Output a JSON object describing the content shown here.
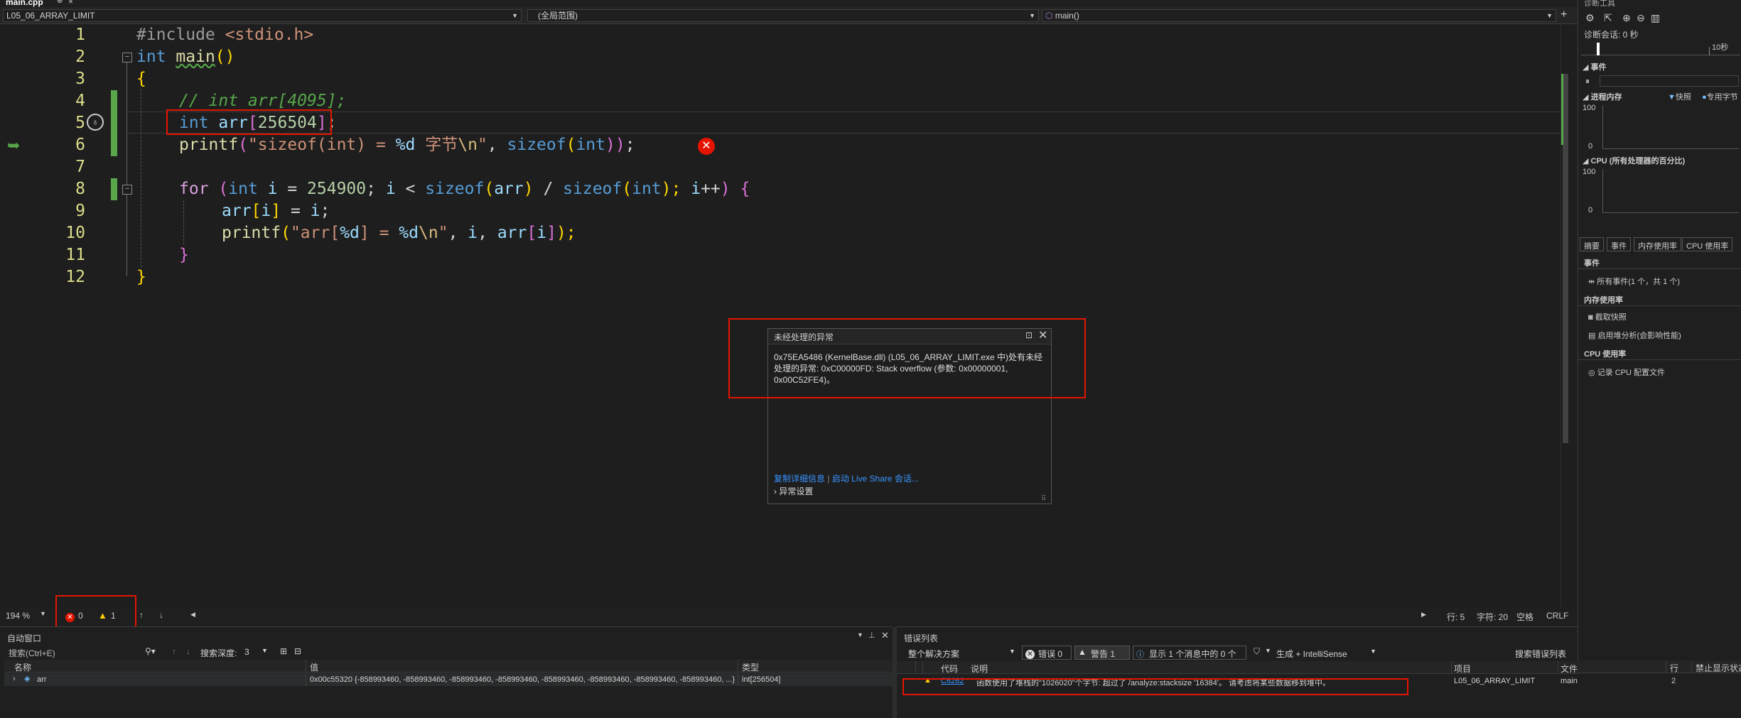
{
  "tab": {
    "filename": "main.cpp",
    "pin": "⊕",
    "close": "×"
  },
  "nav": {
    "project": "L05_06_ARRAY_LIMIT",
    "scope": "(全局范围)",
    "member": "main()"
  },
  "code": {
    "lines": [
      "1",
      "2",
      "3",
      "4",
      "5",
      "6",
      "7",
      "8",
      "9",
      "10",
      "11",
      "12"
    ],
    "l1_pp": "#include",
    "l1_inc": " <stdio.h>",
    "l2_kw": "int",
    "l2_fn": "main",
    "l2_rest": "()",
    "l3": "{",
    "l4": "// int arr[4095];",
    "l5_kw": "int",
    "l5_var": " arr",
    "l5_br1": "[",
    "l5_num": "256504",
    "l5_br2": "]",
    "l5_end": ";",
    "l6_fn": "printf",
    "l6_p1": "(",
    "l6_str1": "\"sizeof(int) = ",
    "l6_fmt": "%d",
    "l6_str2": " 字节",
    "l6_esc": "\\n",
    "l6_str3": "\"",
    "l6_sep": ", ",
    "l6_sz": "sizeof",
    "l6_p2": "(",
    "l6_int": "int",
    "l6_p3": "))",
    "l6_end": ";",
    "l8_for": "for",
    "l8_p1": " (",
    "l8_int": "int",
    "l8_i": " i",
    "l8_eq": " = ",
    "l8_num": "254900",
    "l8_semi": "; ",
    "l8_i2": "i",
    "l8_lt": " < ",
    "l8_sz1": "sizeof",
    "l8_p2": "(",
    "l8_arr": "arr",
    "l8_p3": ")",
    "l8_div": " / ",
    "l8_sz2": "sizeof",
    "l8_p4": "(",
    "l8_int2": "int",
    "l8_p5": "); ",
    "l8_i3": "i",
    "l8_inc": "++",
    "l8_p6": ") ",
    "l8_brace": "{",
    "l9_arr": "arr",
    "l9_b1": "[",
    "l9_i": "i",
    "l9_b2": "]",
    "l9_rest": " = ",
    "l9_i2": "i",
    "l9_end": ";",
    "l10_fn": "printf",
    "l10_p1": "(",
    "l10_s1": "\"arr[",
    "l10_f1": "%d",
    "l10_s2": "] = ",
    "l10_f2": "%d",
    "l10_esc": "\\n",
    "l10_s3": "\"",
    "l10_rest": ", ",
    "l10_i": "i",
    "l10_c": ", ",
    "l10_arr": "arr",
    "l10_b1": "[",
    "l10_i2": "i",
    "l10_b2": "]",
    "l10_end": ");",
    "l11": "}",
    "l12": "}"
  },
  "exception": {
    "title": "未经处理的异常",
    "message": "0x75EA5486 (KernelBase.dll) (L05_06_ARRAY_LIMIT.exe 中)处有未经处理的异常: 0xC00000FD: Stack overflow (参数: 0x00000001, 0x00C52FE4)。",
    "copy_details": "复制详细信息",
    "separator": "|",
    "live_share": "启动 Live Share 会话...",
    "settings": "异常设置"
  },
  "status": {
    "zoom": "194 %",
    "errors": "0",
    "warnings": "1",
    "line": "行: 5",
    "char": "字符: 20",
    "space": "空格",
    "eol": "CRLF"
  },
  "autos": {
    "title": "自动窗口",
    "search_placeholder": "搜索(Ctrl+E)",
    "search_depth_label": "搜索深度:",
    "search_depth": "3",
    "col_name": "名称",
    "col_value": "值",
    "col_type": "类型",
    "row_name": "arr",
    "row_value": "0x00c55320 {-858993460, -858993460, -858993460, -858993460, -858993460, -858993460, -858993460, -858993460, ...}",
    "row_type": "int[256504]"
  },
  "errors_list": {
    "title": "错误列表",
    "scope": "整个解决方案",
    "errors_btn": "错误 0",
    "warnings_btn": "警告 1",
    "messages_btn": "显示 1 个消息中的 0 个",
    "build_filter": "生成 + IntelliSense",
    "search": "搜索错误列表",
    "col_code": "代码",
    "col_desc": "说明",
    "col_project": "项目",
    "col_file": "文件",
    "col_line": "行",
    "col_suppress": "禁止显示状态",
    "row_code": "C6262",
    "row_desc": "函数使用了堆栈的\"1026020\"个字节: 超过了 /analyze:stacksize '16384'。 请考虑将某些数据移到堆中。",
    "row_project": "L05_06_ARRAY_LIMIT",
    "row_file": "main.cpp",
    "row_line": "2"
  },
  "diag": {
    "title": "诊断工具",
    "session": "诊断会话: 0 秒",
    "time_tick": "10秒",
    "events": "事件",
    "process_memory": "进程内存",
    "snapshot": "快照",
    "dedicated": "专用字节",
    "mem_max": "100",
    "mem_min": "0",
    "cpu": "CPU (所有处理器的百分比)",
    "cpu_max": "100",
    "cpu_min": "0",
    "tab_summary": "摘要",
    "tab_events": "事件",
    "tab_memory": "内存使用率",
    "tab_cpu": "CPU 使用率",
    "sec_events": "事件",
    "all_events": "所有事件(1 个，共 1 个)",
    "sec_memory": "内存使用率",
    "take_snapshot": "截取快照",
    "heap_profile": "启用堆分析(会影响性能)",
    "sec_cpu": "CPU 使用率",
    "record_cpu": "记录 CPU 配置文件"
  }
}
